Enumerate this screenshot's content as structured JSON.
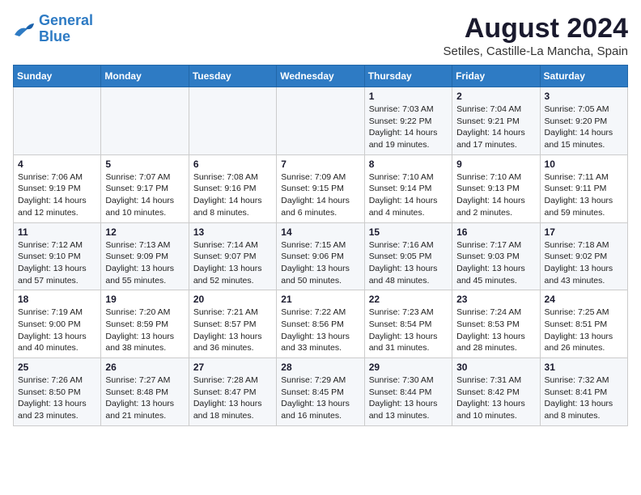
{
  "logo": {
    "line1": "General",
    "line2": "Blue"
  },
  "title": "August 2024",
  "location": "Setiles, Castille-La Mancha, Spain",
  "headers": [
    "Sunday",
    "Monday",
    "Tuesday",
    "Wednesday",
    "Thursday",
    "Friday",
    "Saturday"
  ],
  "weeks": [
    [
      {
        "day": "",
        "info": ""
      },
      {
        "day": "",
        "info": ""
      },
      {
        "day": "",
        "info": ""
      },
      {
        "day": "",
        "info": ""
      },
      {
        "day": "1",
        "info": "Sunrise: 7:03 AM\nSunset: 9:22 PM\nDaylight: 14 hours\nand 19 minutes."
      },
      {
        "day": "2",
        "info": "Sunrise: 7:04 AM\nSunset: 9:21 PM\nDaylight: 14 hours\nand 17 minutes."
      },
      {
        "day": "3",
        "info": "Sunrise: 7:05 AM\nSunset: 9:20 PM\nDaylight: 14 hours\nand 15 minutes."
      }
    ],
    [
      {
        "day": "4",
        "info": "Sunrise: 7:06 AM\nSunset: 9:19 PM\nDaylight: 14 hours\nand 12 minutes."
      },
      {
        "day": "5",
        "info": "Sunrise: 7:07 AM\nSunset: 9:17 PM\nDaylight: 14 hours\nand 10 minutes."
      },
      {
        "day": "6",
        "info": "Sunrise: 7:08 AM\nSunset: 9:16 PM\nDaylight: 14 hours\nand 8 minutes."
      },
      {
        "day": "7",
        "info": "Sunrise: 7:09 AM\nSunset: 9:15 PM\nDaylight: 14 hours\nand 6 minutes."
      },
      {
        "day": "8",
        "info": "Sunrise: 7:10 AM\nSunset: 9:14 PM\nDaylight: 14 hours\nand 4 minutes."
      },
      {
        "day": "9",
        "info": "Sunrise: 7:10 AM\nSunset: 9:13 PM\nDaylight: 14 hours\nand 2 minutes."
      },
      {
        "day": "10",
        "info": "Sunrise: 7:11 AM\nSunset: 9:11 PM\nDaylight: 13 hours\nand 59 minutes."
      }
    ],
    [
      {
        "day": "11",
        "info": "Sunrise: 7:12 AM\nSunset: 9:10 PM\nDaylight: 13 hours\nand 57 minutes."
      },
      {
        "day": "12",
        "info": "Sunrise: 7:13 AM\nSunset: 9:09 PM\nDaylight: 13 hours\nand 55 minutes."
      },
      {
        "day": "13",
        "info": "Sunrise: 7:14 AM\nSunset: 9:07 PM\nDaylight: 13 hours\nand 52 minutes."
      },
      {
        "day": "14",
        "info": "Sunrise: 7:15 AM\nSunset: 9:06 PM\nDaylight: 13 hours\nand 50 minutes."
      },
      {
        "day": "15",
        "info": "Sunrise: 7:16 AM\nSunset: 9:05 PM\nDaylight: 13 hours\nand 48 minutes."
      },
      {
        "day": "16",
        "info": "Sunrise: 7:17 AM\nSunset: 9:03 PM\nDaylight: 13 hours\nand 45 minutes."
      },
      {
        "day": "17",
        "info": "Sunrise: 7:18 AM\nSunset: 9:02 PM\nDaylight: 13 hours\nand 43 minutes."
      }
    ],
    [
      {
        "day": "18",
        "info": "Sunrise: 7:19 AM\nSunset: 9:00 PM\nDaylight: 13 hours\nand 40 minutes."
      },
      {
        "day": "19",
        "info": "Sunrise: 7:20 AM\nSunset: 8:59 PM\nDaylight: 13 hours\nand 38 minutes."
      },
      {
        "day": "20",
        "info": "Sunrise: 7:21 AM\nSunset: 8:57 PM\nDaylight: 13 hours\nand 36 minutes."
      },
      {
        "day": "21",
        "info": "Sunrise: 7:22 AM\nSunset: 8:56 PM\nDaylight: 13 hours\nand 33 minutes."
      },
      {
        "day": "22",
        "info": "Sunrise: 7:23 AM\nSunset: 8:54 PM\nDaylight: 13 hours\nand 31 minutes."
      },
      {
        "day": "23",
        "info": "Sunrise: 7:24 AM\nSunset: 8:53 PM\nDaylight: 13 hours\nand 28 minutes."
      },
      {
        "day": "24",
        "info": "Sunrise: 7:25 AM\nSunset: 8:51 PM\nDaylight: 13 hours\nand 26 minutes."
      }
    ],
    [
      {
        "day": "25",
        "info": "Sunrise: 7:26 AM\nSunset: 8:50 PM\nDaylight: 13 hours\nand 23 minutes."
      },
      {
        "day": "26",
        "info": "Sunrise: 7:27 AM\nSunset: 8:48 PM\nDaylight: 13 hours\nand 21 minutes."
      },
      {
        "day": "27",
        "info": "Sunrise: 7:28 AM\nSunset: 8:47 PM\nDaylight: 13 hours\nand 18 minutes."
      },
      {
        "day": "28",
        "info": "Sunrise: 7:29 AM\nSunset: 8:45 PM\nDaylight: 13 hours\nand 16 minutes."
      },
      {
        "day": "29",
        "info": "Sunrise: 7:30 AM\nSunset: 8:44 PM\nDaylight: 13 hours\nand 13 minutes."
      },
      {
        "day": "30",
        "info": "Sunrise: 7:31 AM\nSunset: 8:42 PM\nDaylight: 13 hours\nand 10 minutes."
      },
      {
        "day": "31",
        "info": "Sunrise: 7:32 AM\nSunset: 8:41 PM\nDaylight: 13 hours\nand 8 minutes."
      }
    ]
  ]
}
